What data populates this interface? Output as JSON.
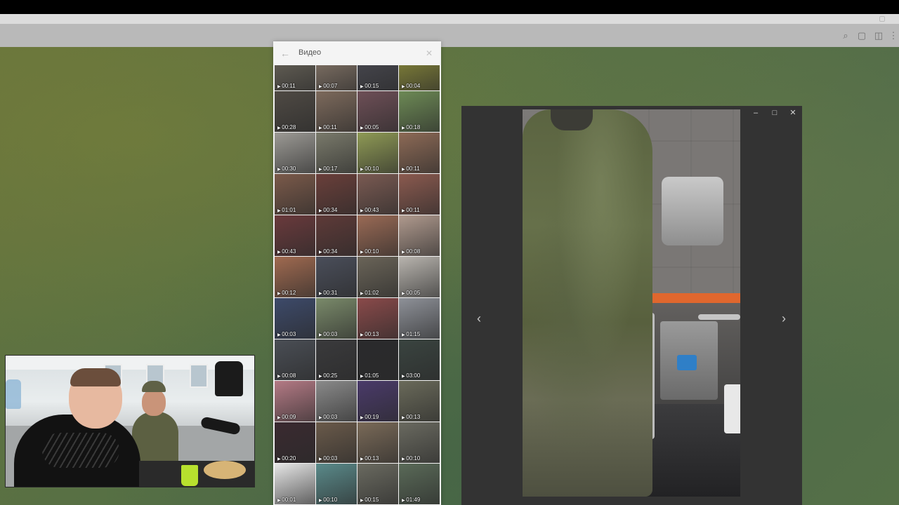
{
  "media_panel": {
    "title": "Видео",
    "thumbs": [
      {
        "dur": "00:11",
        "color": "#6b665b"
      },
      {
        "dur": "00:07",
        "color": "#8a7a6c"
      },
      {
        "dur": "00:15",
        "color": "#4a4a52"
      },
      {
        "dur": "00:04",
        "color": "#8a8a3a"
      },
      {
        "dur": "00:28",
        "color": "#4f4a44"
      },
      {
        "dur": "00:11",
        "color": "#7d6a5c"
      },
      {
        "dur": "00:05",
        "color": "#6e4f57"
      },
      {
        "dur": "00:18",
        "color": "#6d8a55"
      },
      {
        "dur": "00:30",
        "color": "#9c9a95"
      },
      {
        "dur": "00:17",
        "color": "#7a7a6b"
      },
      {
        "dur": "00:10",
        "color": "#8f9a55"
      },
      {
        "dur": "00:11",
        "color": "#8d6a56"
      },
      {
        "dur": "01:01",
        "color": "#7b5a4a"
      },
      {
        "dur": "00:34",
        "color": "#6a3f3a"
      },
      {
        "dur": "00:43",
        "color": "#7a5a52"
      },
      {
        "dur": "00:11",
        "color": "#8b5a4f"
      },
      {
        "dur": "00:43",
        "color": "#6a3a3c"
      },
      {
        "dur": "00:34",
        "color": "#5e3a38"
      },
      {
        "dur": "00:10",
        "color": "#9a6a55"
      },
      {
        "dur": "00:08",
        "color": "#b09a8e"
      },
      {
        "dur": "00:12",
        "color": "#a06a50"
      },
      {
        "dur": "00:31",
        "color": "#4a4e5a"
      },
      {
        "dur": "01:02",
        "color": "#6a6458"
      },
      {
        "dur": "00:05",
        "color": "#b8b4ae"
      },
      {
        "dur": "00:03",
        "color": "#3d4a6a"
      },
      {
        "dur": "00:03",
        "color": "#7a8a6a"
      },
      {
        "dur": "00:13",
        "color": "#8a4a4a"
      },
      {
        "dur": "01:15",
        "color": "#8e9198"
      },
      {
        "dur": "00:08",
        "color": "#4a4e55"
      },
      {
        "dur": "00:25",
        "color": "#3a3a3c"
      },
      {
        "dur": "01:05",
        "color": "#2a2a2c"
      },
      {
        "dur": "03:00",
        "color": "#3a4440"
      },
      {
        "dur": "00:09",
        "color": "#b47a85"
      },
      {
        "dur": "00:03",
        "color": "#8a8a8a"
      },
      {
        "dur": "00:19",
        "color": "#4a3a6a"
      },
      {
        "dur": "00:13",
        "color": "#6a6a5a"
      },
      {
        "dur": "00:20",
        "color": "#3a2a30"
      },
      {
        "dur": "00:03",
        "color": "#6a5a4a"
      },
      {
        "dur": "00:13",
        "color": "#7a6a58"
      },
      {
        "dur": "00:10",
        "color": "#6a6a60"
      },
      {
        "dur": "00:01",
        "color": "#e6e6e6"
      },
      {
        "dur": "00:10",
        "color": "#5a8a8a"
      },
      {
        "dur": "00:15",
        "color": "#6a6a60"
      },
      {
        "dur": "01:49",
        "color": "#5a6a58"
      }
    ]
  },
  "viewer": {
    "prev_icon": "chevron-left-icon",
    "next_icon": "chevron-right-icon",
    "minimize_icon": "minimize-icon",
    "maximize_icon": "maximize-icon",
    "close_icon": "close-icon"
  },
  "header_icons": [
    "search-icon",
    "comments-icon",
    "sidebar-icon",
    "more-icon"
  ],
  "colors": {
    "chat_bg": "#5f7a4a",
    "panel_bg": "#f4f4f4",
    "viewer_bg": "#333333"
  }
}
